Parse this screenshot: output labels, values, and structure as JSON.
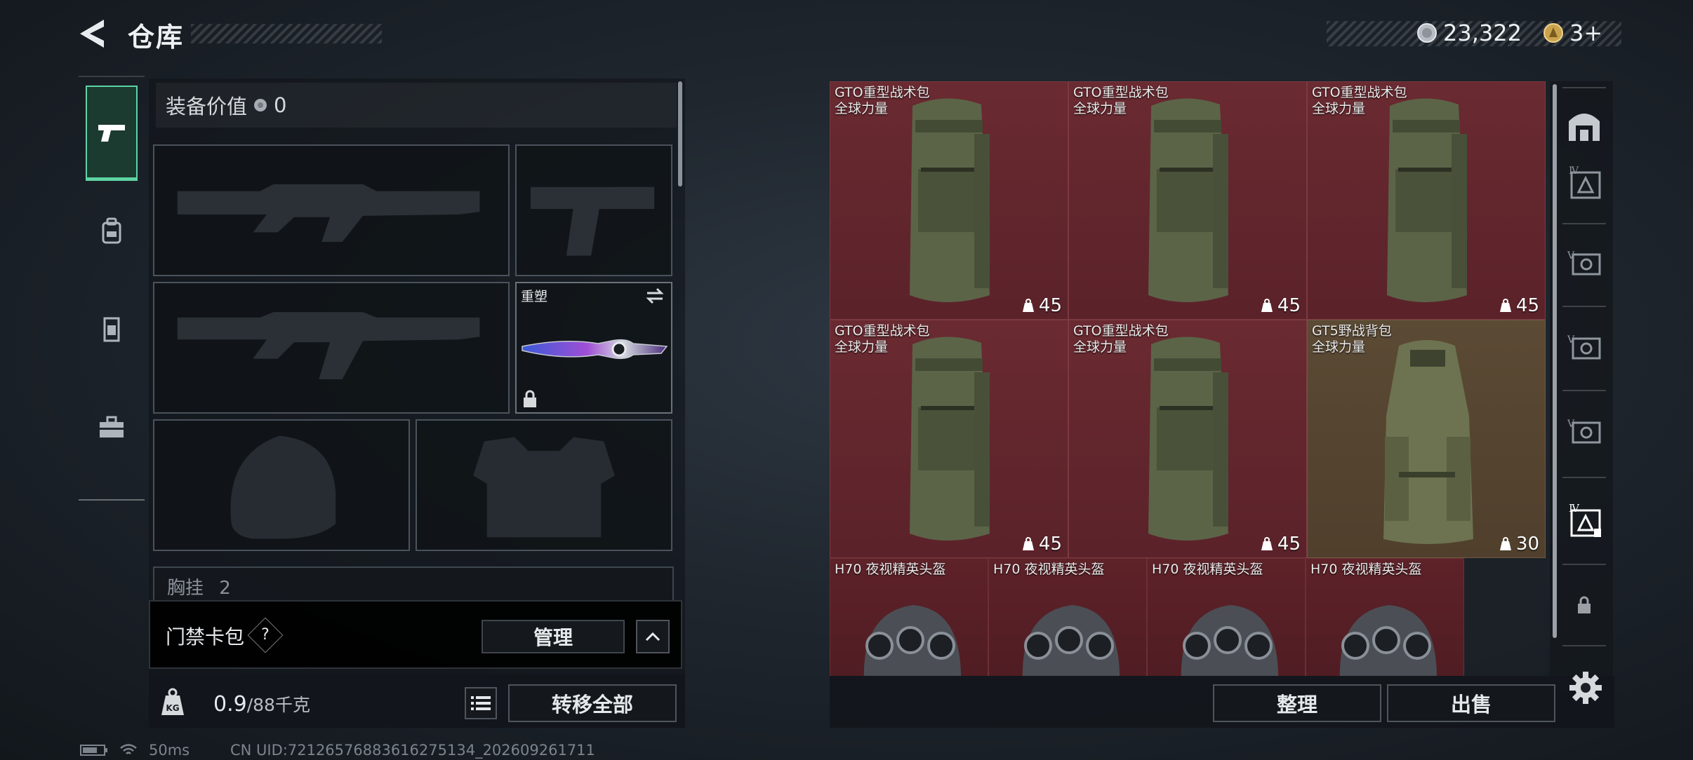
{
  "header": {
    "title": "仓库",
    "currency_1": "23,322",
    "currency_2": "3+"
  },
  "equipment": {
    "value_label": "装备价值",
    "value_amount": "0",
    "melee_label": "重塑",
    "chest_label": "胸挂",
    "chest_count": "2"
  },
  "access_card": {
    "label": "门禁卡包",
    "help": "?",
    "manage": "管理"
  },
  "footer_left": {
    "weight_value": "0.9",
    "weight_max": "/88千克",
    "transfer_all": "转移全部"
  },
  "storage": {
    "items": [
      {
        "name": "GTO重型战术包",
        "sub": "全球力量",
        "count": "45"
      },
      {
        "name": "GTO重型战术包",
        "sub": "全球力量",
        "count": "45"
      },
      {
        "name": "GTO重型战术包",
        "sub": "全球力量",
        "count": "45"
      },
      {
        "name": "GTO重型战术包",
        "sub": "全球力量",
        "count": "45"
      },
      {
        "name": "GTO重型战术包",
        "sub": "全球力量",
        "count": "45"
      },
      {
        "name": "GT5野战背包",
        "sub": "全球力量",
        "count": "30"
      },
      {
        "name": "H70 夜视精英头盔"
      },
      {
        "name": "H70 夜视精英头盔"
      },
      {
        "name": "H70 夜视精英头盔"
      },
      {
        "name": "H70 夜视精英头盔"
      }
    ],
    "sort": "整理",
    "sell": "出售"
  },
  "right_tabs": {
    "tier_labels": [
      "Ⅳ",
      "Ⅴ",
      "Ⅴ",
      "Ⅴ",
      "Ⅳ"
    ]
  },
  "status": {
    "ping": "50ms",
    "uid": "CN UID:72126576883616275134_202609261711"
  },
  "colors": {
    "accent": "#5fd3a3",
    "item_red": "#6a2a31",
    "item_olive": "#5b4a34"
  }
}
